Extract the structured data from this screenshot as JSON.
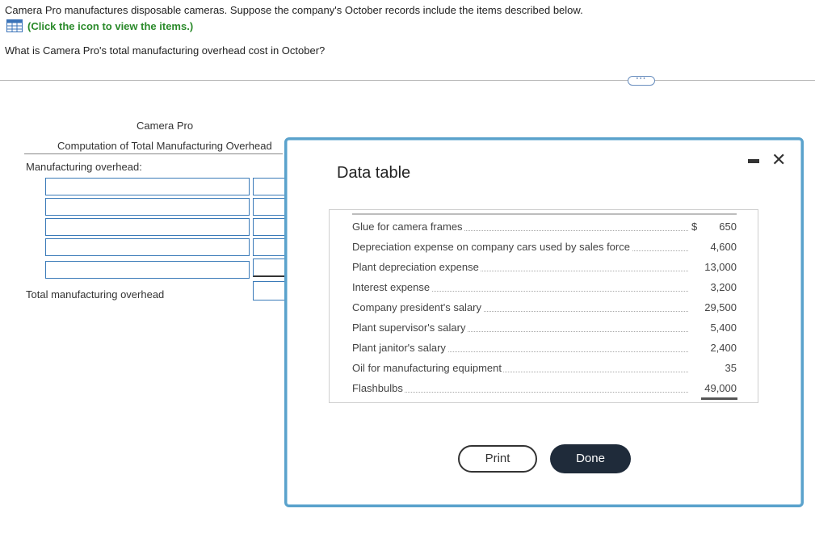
{
  "question": {
    "intro": "Camera Pro manufactures disposable cameras. Suppose the company's October records include the items described below.",
    "hint": "(Click the icon to view the items.)",
    "prompt": "What is Camera Pro's total manufacturing overhead cost in October?"
  },
  "worksheet": {
    "company": "Camera Pro",
    "title": "Computation of Total Manufacturing Overhead",
    "section_label": "Manufacturing overhead:",
    "total_label": "Total manufacturing overhead",
    "input_rows": 5
  },
  "modal": {
    "title": "Data table",
    "rows": [
      {
        "label": "Glue for camera frames",
        "currency": "$",
        "value": "650"
      },
      {
        "label": "Depreciation expense on company cars used by sales force",
        "currency": "",
        "value": "4,600"
      },
      {
        "label": "Plant depreciation expense",
        "currency": "",
        "value": "13,000"
      },
      {
        "label": "Interest expense",
        "currency": "",
        "value": "3,200"
      },
      {
        "label": "Company president's salary",
        "currency": "",
        "value": "29,500"
      },
      {
        "label": "Plant supervisor's salary",
        "currency": "",
        "value": "5,400"
      },
      {
        "label": "Plant janitor's salary",
        "currency": "",
        "value": "2,400"
      },
      {
        "label": "Oil for manufacturing equipment",
        "currency": "",
        "value": "35"
      },
      {
        "label": "Flashbulbs",
        "currency": "",
        "value": "49,000"
      }
    ],
    "print_label": "Print",
    "done_label": "Done",
    "close_glyph": "✕"
  },
  "icons": {
    "hint_icon": "table-grid-icon",
    "more_icon": "ellipsis-icon"
  },
  "colors": {
    "hint_green": "#2a8a2a",
    "input_border": "#3a7ab8",
    "modal_border": "#5aa2cc",
    "done_bg": "#1f2b3a"
  }
}
